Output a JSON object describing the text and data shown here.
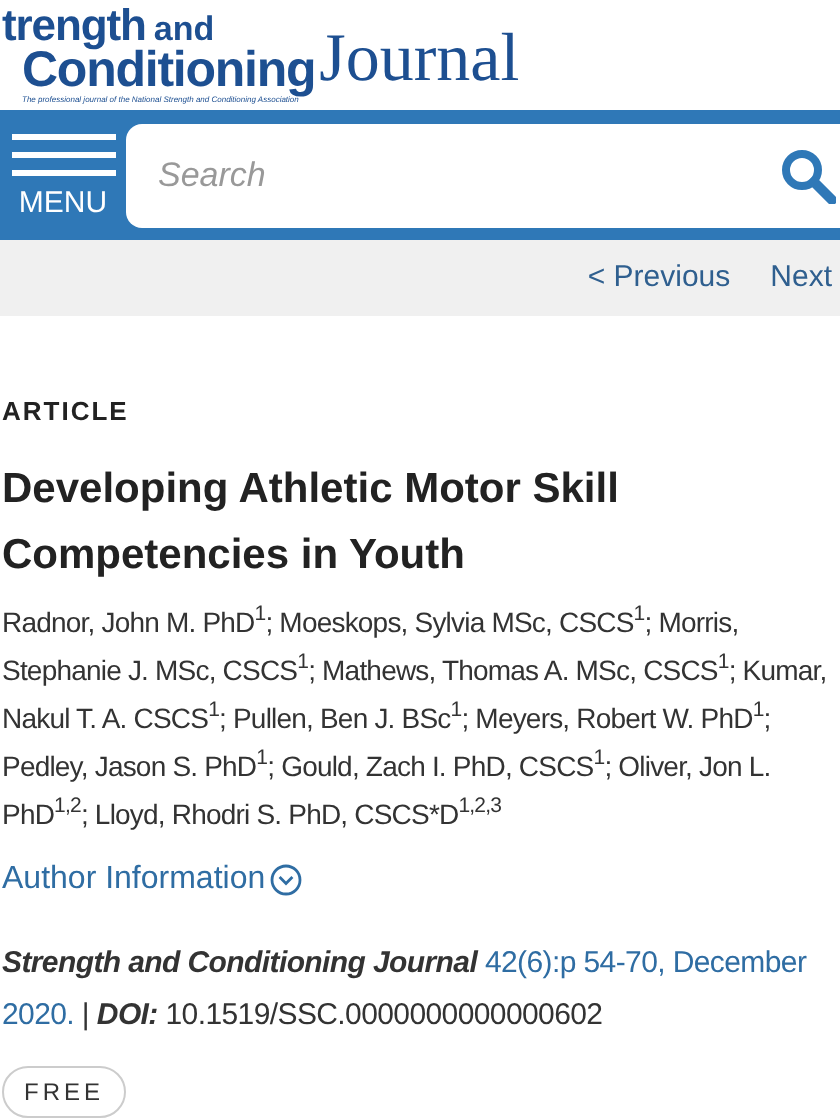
{
  "logo": {
    "line_1": "trength",
    "line_2": "and",
    "line_3": "Conditioning",
    "line_4": "Journal",
    "tagline": "The professional journal of the National Strength and Conditioning Association"
  },
  "menu": {
    "label": "MENU"
  },
  "search": {
    "placeholder": "Search"
  },
  "pager": {
    "previous": "< Previous",
    "next": "Next"
  },
  "article": {
    "type": "ARTICLE",
    "title": "Developing Athletic Motor Skill Competencies in Youth",
    "authors": "Radnor, John M. PhD$^{1}$; Moeskops, Sylvia MSc, CSCS$^{1}$; Morris, Stephanie J. MSc, CSCS$^{1}$; Mathews, Thomas A. MSc, CSCS$^{1}$; Kumar, Nakul T. A. CSCS$^{1}$; Pullen, Ben J. BSc$^{1}$; Meyers, Robert W. PhD$^{1}$; Pedley, Jason S. PhD$^{1}$; Gould, Zach I. PhD, CSCS$^{1}$; Oliver, Jon L. PhD$^{1,2}$; Lloyd, Rhodri S. PhD, CSCS*D$^{1,2,3}$",
    "author_info": "Author Information",
    "journal": "Strength and Conditioning Journal",
    "issue": "42(6):p 54-70, December 2020.",
    "separator": "|",
    "doi_label": "DOI:",
    "doi": "10.1519/SSC.0000000000000602",
    "badge": "FREE"
  }
}
